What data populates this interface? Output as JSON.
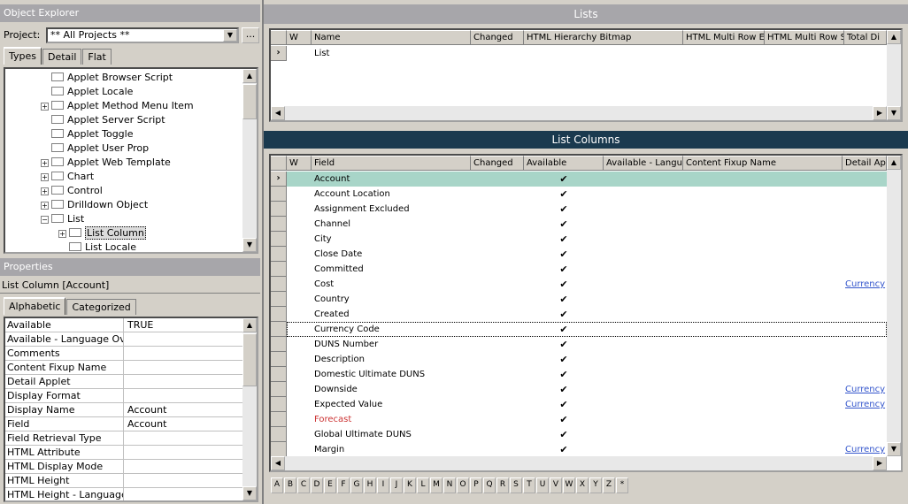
{
  "object_explorer": {
    "title": "Object Explorer",
    "project_label": "Project:",
    "project_value": "** All Projects **",
    "browse_label": "...",
    "tabs": [
      "Types",
      "Detail",
      "Flat"
    ],
    "tree": [
      {
        "label": "Applet Browser Script",
        "indent": 0,
        "expander": false
      },
      {
        "label": "Applet Locale",
        "indent": 0,
        "expander": false
      },
      {
        "label": "Applet Method Menu Item",
        "indent": 0,
        "expander": true
      },
      {
        "label": "Applet Server Script",
        "indent": 0,
        "expander": false
      },
      {
        "label": "Applet Toggle",
        "indent": 0,
        "expander": false
      },
      {
        "label": "Applet User Prop",
        "indent": 0,
        "expander": false
      },
      {
        "label": "Applet Web Template",
        "indent": 0,
        "expander": true
      },
      {
        "label": "Chart",
        "indent": 0,
        "expander": true
      },
      {
        "label": "Control",
        "indent": 0,
        "expander": true
      },
      {
        "label": "Drilldown Object",
        "indent": 0,
        "expander": true
      },
      {
        "label": "List",
        "indent": 0,
        "expander": "minus"
      },
      {
        "label": "List Column",
        "indent": 1,
        "expander": true,
        "selected": true
      },
      {
        "label": "List Locale",
        "indent": 1,
        "expander": false
      }
    ]
  },
  "properties": {
    "title": "Properties",
    "object": "List Column [Account]",
    "tabs": [
      "Alphabetic",
      "Categorized"
    ],
    "rows": [
      {
        "k": "Available",
        "v": "TRUE"
      },
      {
        "k": "Available - Language Overri",
        "v": ""
      },
      {
        "k": "Comments",
        "v": ""
      },
      {
        "k": "Content Fixup Name",
        "v": ""
      },
      {
        "k": "Detail Applet",
        "v": ""
      },
      {
        "k": "Display Format",
        "v": ""
      },
      {
        "k": "Display Name",
        "v": "Account"
      },
      {
        "k": "Field",
        "v": "Account"
      },
      {
        "k": "Field Retrieval Type",
        "v": ""
      },
      {
        "k": "HTML Attribute",
        "v": ""
      },
      {
        "k": "HTML Display Mode",
        "v": ""
      },
      {
        "k": "HTML Height",
        "v": ""
      },
      {
        "k": "HTML Height - Language O",
        "v": ""
      }
    ]
  },
  "lists": {
    "title": "Lists",
    "columns": [
      "W",
      "Name",
      "Changed",
      "HTML Hierarchy Bitmap",
      "HTML Multi Row E",
      "HTML Multi Row S",
      "Total Di"
    ],
    "rows": [
      {
        "name": "List"
      }
    ]
  },
  "list_columns": {
    "title": "List Columns",
    "columns": [
      "W",
      "Field",
      "Changed",
      "Available",
      "Available - Langua",
      "Content Fixup Name",
      "Detail Ap"
    ],
    "check": "✔",
    "rows": [
      {
        "field": "Account",
        "available": true,
        "detail": "",
        "selected": true
      },
      {
        "field": "Account Location",
        "available": true,
        "detail": ""
      },
      {
        "field": "Assignment Excluded",
        "available": true,
        "detail": ""
      },
      {
        "field": "Channel",
        "available": true,
        "detail": ""
      },
      {
        "field": "City",
        "available": true,
        "detail": ""
      },
      {
        "field": "Close Date",
        "available": true,
        "detail": ""
      },
      {
        "field": "Committed",
        "available": true,
        "detail": ""
      },
      {
        "field": "Cost",
        "available": true,
        "detail": "Currency"
      },
      {
        "field": "Country",
        "available": true,
        "detail": ""
      },
      {
        "field": "Created",
        "available": true,
        "detail": ""
      },
      {
        "field": "Currency Code",
        "available": true,
        "detail": "",
        "focused": true
      },
      {
        "field": "DUNS Number",
        "available": true,
        "detail": ""
      },
      {
        "field": "Description",
        "available": true,
        "detail": ""
      },
      {
        "field": "Domestic Ultimate DUNS",
        "available": true,
        "detail": ""
      },
      {
        "field": "Downside",
        "available": true,
        "detail": "Currency"
      },
      {
        "field": "Expected Value",
        "available": true,
        "detail": "Currency"
      },
      {
        "field": "Forecast",
        "available": true,
        "detail": "",
        "red": true
      },
      {
        "field": "Global Ultimate DUNS",
        "available": true,
        "detail": ""
      },
      {
        "field": "Margin",
        "available": true,
        "detail": "Currency"
      }
    ]
  },
  "alphabet": [
    "A",
    "B",
    "C",
    "D",
    "E",
    "F",
    "G",
    "H",
    "I",
    "J",
    "K",
    "L",
    "M",
    "N",
    "O",
    "P",
    "Q",
    "R",
    "S",
    "T",
    "U",
    "V",
    "W",
    "X",
    "Y",
    "Z",
    "*"
  ]
}
